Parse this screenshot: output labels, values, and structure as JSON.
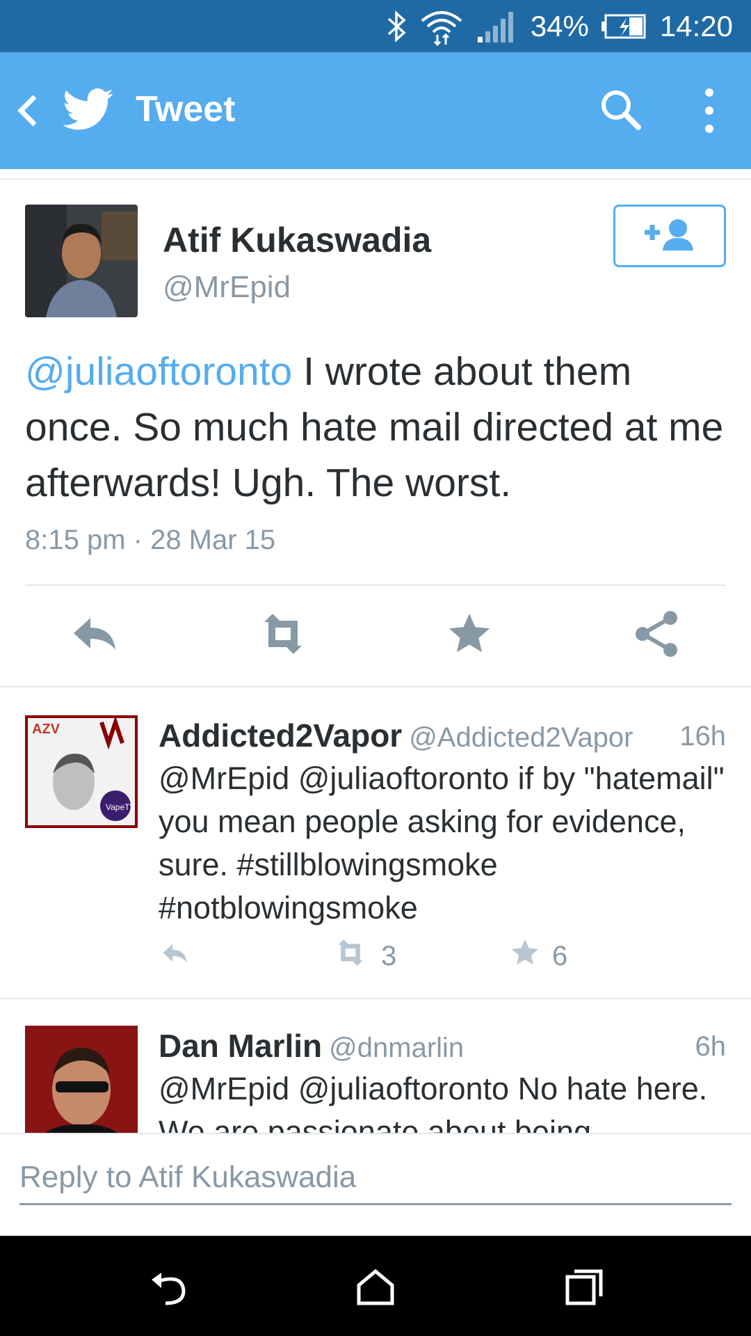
{
  "status_bar": {
    "battery": "34%",
    "time": "14:20"
  },
  "app_bar": {
    "title": "Tweet"
  },
  "tweet": {
    "author_name": "Atif Kukaswadia",
    "author_handle": "@MrEpid",
    "mention": "@juliaoftoronto",
    "text": " I wrote about them once. So much hate mail directed at me afterwards! Ugh. The worst.",
    "timestamp": "8:15 pm · 28 Mar 15"
  },
  "replies": [
    {
      "name": "Addicted2Vapor",
      "handle": "@Addicted2Vapor",
      "time": "16h",
      "text": "@MrEpid @juliaoftoronto if by \"hatemail\" you mean people asking for evidence, sure. #stillblowingsmoke #notblowingsmoke",
      "retweets": "3",
      "favorites": "6"
    },
    {
      "name": "Dan Marlin",
      "handle": "@dnmarlin",
      "time": "6h",
      "text": "@MrEpid @juliaoftoronto No hate here. We are passionate about being"
    }
  ],
  "composer": {
    "placeholder": "Reply to Atif Kukaswadia"
  },
  "colors": {
    "status_bar": "#1f6aa5",
    "app_bar": "#55acee",
    "accent": "#55acee",
    "muted": "#8899a6",
    "text": "#292f33"
  },
  "icons": [
    "bluetooth-icon",
    "wifi-icon",
    "signal-icon",
    "battery-icon",
    "back-icon",
    "twitter-bird-icon",
    "search-icon",
    "overflow-menu-icon",
    "follow-icon",
    "reply-icon",
    "retweet-icon",
    "favorite-icon",
    "share-icon",
    "nav-back-icon",
    "nav-home-icon",
    "nav-recents-icon"
  ]
}
